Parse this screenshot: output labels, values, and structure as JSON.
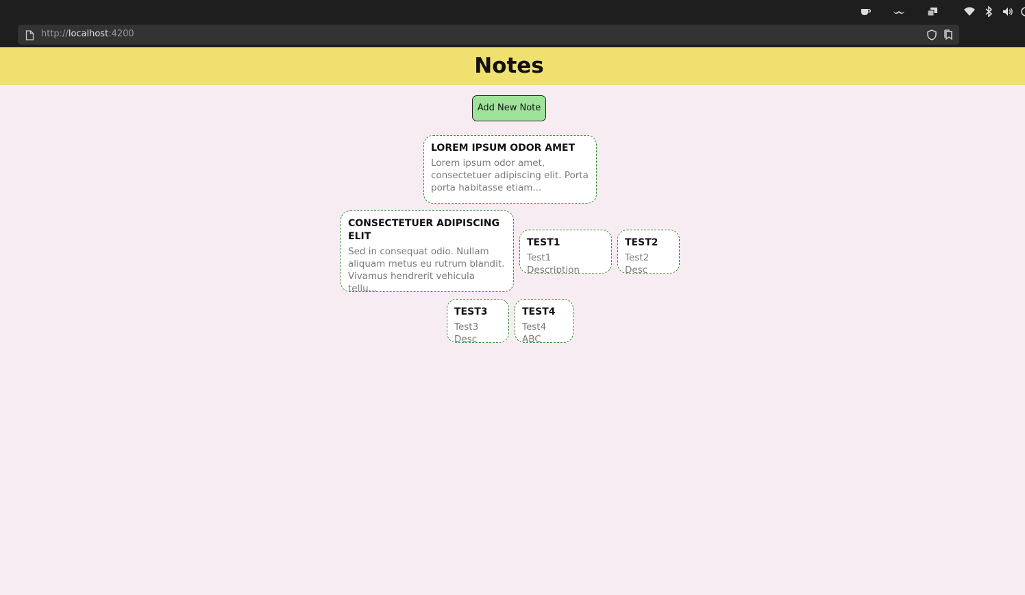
{
  "browser": {
    "url_scheme": "http://",
    "url_host": "localhost",
    "url_port": ":4200"
  },
  "app": {
    "title": "Notes",
    "add_button_label": "Add New Note"
  },
  "notes": [
    {
      "title": "LOREM IPSUM ODOR AMET",
      "description": "Lorem ipsum odor amet, consectetuer adipiscing elit. Porta porta habitasse etiam..."
    },
    {
      "title": "CONSECTETUER ADIPISCING ELIT",
      "description": "Sed in consequat odio. Nullam aliquam metus eu rutrum blandit. Vivamus hendrerit vehicula tellu..."
    },
    {
      "title": "TEST1",
      "description": "Test1 Description"
    },
    {
      "title": "TEST2",
      "description": "Test2 Desc"
    },
    {
      "title": "TEST3",
      "description": "Test3 Desc"
    },
    {
      "title": "TEST4",
      "description": "Test4 ABC"
    }
  ],
  "colors": {
    "header_bg": "#efe06f",
    "page_bg": "#f7ecf1",
    "button_bg": "#9fe39a",
    "note_border": "#2e8b2e"
  },
  "system_tray_icons": [
    "coffee-icon",
    "mustache-icon",
    "windows-icon",
    "wifi-icon",
    "bluetooth-icon",
    "volume-icon"
  ]
}
